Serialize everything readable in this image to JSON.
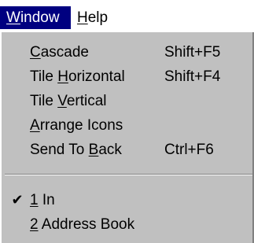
{
  "menubar": {
    "items": [
      {
        "pre": "",
        "u": "W",
        "post": "indow",
        "active": true
      },
      {
        "pre": "",
        "u": "H",
        "post": "elp",
        "active": false
      }
    ]
  },
  "menu": {
    "items": [
      {
        "pre": "",
        "u": "C",
        "post": "ascade",
        "shortcut": "Shift+F5"
      },
      {
        "pre": "Tile ",
        "u": "H",
        "post": "orizontal",
        "shortcut": "Shift+F4"
      },
      {
        "pre": "Tile ",
        "u": "V",
        "post": "ertical",
        "shortcut": ""
      },
      {
        "pre": "",
        "u": "A",
        "post": "rrange Icons",
        "shortcut": ""
      },
      {
        "pre": "Send To ",
        "u": "B",
        "post": "ack",
        "shortcut": "Ctrl+F6"
      }
    ],
    "windows": [
      {
        "checked": true,
        "check": "✔",
        "pre": "",
        "u": "1",
        "post": " In"
      },
      {
        "checked": false,
        "check": "",
        "pre": "",
        "u": "2",
        "post": " Address Book"
      }
    ]
  },
  "colors": {
    "highlight": "#000080",
    "menu_bg": "#c0c0c0"
  },
  "icons": {
    "checkmark": "check-icon"
  }
}
